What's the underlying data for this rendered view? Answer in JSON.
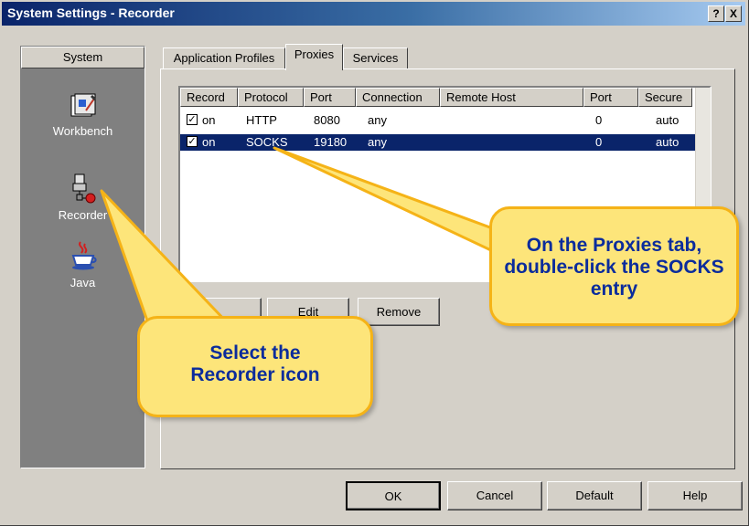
{
  "window": {
    "title": "System Settings - Recorder",
    "help_btn": "?",
    "close_btn": "X"
  },
  "sidebar": {
    "heading": "System",
    "items": [
      {
        "label": "Workbench",
        "icon": "workbench-icon"
      },
      {
        "label": "Recorder",
        "icon": "recorder-icon"
      },
      {
        "label": "Java",
        "icon": "java-icon"
      }
    ]
  },
  "tabs": [
    {
      "label": "Application Profiles",
      "active": false
    },
    {
      "label": "Proxies",
      "active": true
    },
    {
      "label": "Services",
      "active": false
    }
  ],
  "table": {
    "columns": [
      "Record",
      "Protocol",
      "Port",
      "Connection",
      "Remote Host",
      "Port",
      "Secure"
    ],
    "rows": [
      {
        "checked": true,
        "record": "on",
        "protocol": "HTTP",
        "port": "8080",
        "connection": "any",
        "remote_host": "",
        "remote_port": "0",
        "secure": "auto",
        "selected": false
      },
      {
        "checked": true,
        "record": "on",
        "protocol": "SOCKS",
        "port": "19180",
        "connection": "any",
        "remote_host": "",
        "remote_port": "0",
        "secure": "auto",
        "selected": true
      }
    ]
  },
  "table_buttons": {
    "edit": "Edit",
    "remove": "Remove"
  },
  "dialog_buttons": {
    "ok": "OK",
    "cancel": "Cancel",
    "default": "Default",
    "help": "Help"
  },
  "callouts": {
    "proxies": "On the Proxies tab, double-click the SOCKS entry",
    "recorder": "Select the Recorder icon"
  },
  "colors": {
    "callout_fill": "#fde57a",
    "callout_border": "#f5b317",
    "callout_text": "#0b2c9c",
    "selection": "#0a246a"
  }
}
